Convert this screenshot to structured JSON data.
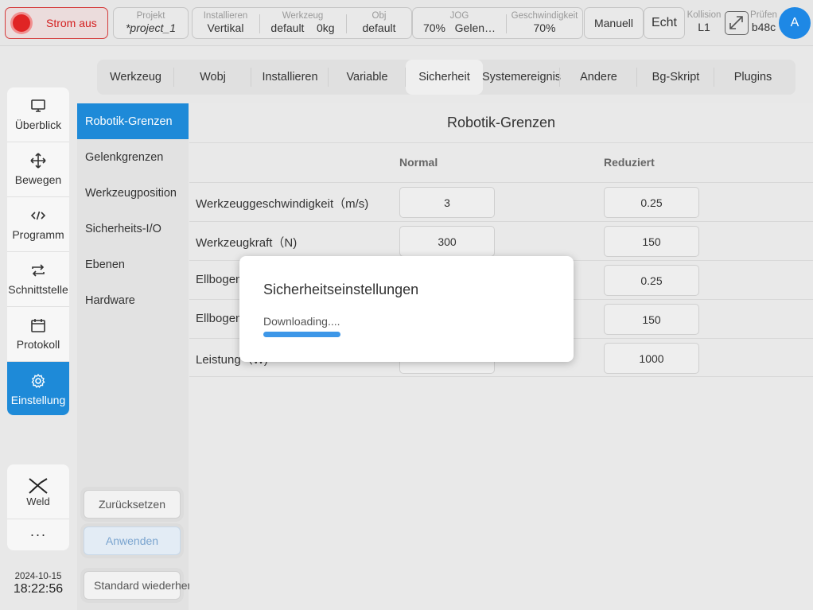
{
  "topbar": {
    "power_label": "Strom aus",
    "project": {
      "title": "Projekt",
      "value": "*project_1"
    },
    "install": {
      "title": "Installieren",
      "value": "Vertikal"
    },
    "tool": {
      "title": "Werkzeug",
      "value": "default",
      "weight": "0kg"
    },
    "obj": {
      "title": "Obj",
      "value": "default"
    },
    "jog": {
      "title": "JOG",
      "value": "70%",
      "mode": "Gelen…"
    },
    "speed": {
      "title": "Geschwindigkeit",
      "value": "70%"
    },
    "manual_label": "Manuell",
    "real_label": "Echt",
    "collision": {
      "title": "Kollision",
      "value": "L1"
    },
    "check": {
      "title": "Prüfen",
      "value": "b48c"
    },
    "avatar_letter": "A"
  },
  "sidebar": {
    "items": [
      {
        "label": "Überblick",
        "icon": "monitor-icon"
      },
      {
        "label": "Bewegen",
        "icon": "move-icon"
      },
      {
        "label": "Programm",
        "icon": "code-icon"
      },
      {
        "label": "Schnittstelle",
        "icon": "swap-icon"
      },
      {
        "label": "Protokoll",
        "icon": "calendar-icon"
      },
      {
        "label": "Einstellung",
        "icon": "gear-icon",
        "active": true
      }
    ],
    "weld_label": "Weld",
    "more_label": "···"
  },
  "datetime": {
    "date": "2024-10-15",
    "time": "18:22:56"
  },
  "tabs": [
    "Werkzeug",
    "Wobj",
    "Installieren",
    "Variable",
    "Sicherheit",
    "Systemereignis",
    "Andere",
    "Bg-Skript",
    "Plugins"
  ],
  "active_tab": "Sicherheit",
  "subnav": {
    "items": [
      "Robotik-Grenzen",
      "Gelenkgrenzen",
      "Werkzeugposition",
      "Sicherheits-I/O",
      "Ebenen",
      "Hardware"
    ],
    "reset_label": "Zurücksetzen",
    "apply_label": "Anwenden",
    "standard_label": "Standard wiederherstellen"
  },
  "content": {
    "title": "Robotik-Grenzen",
    "col_normal": "Normal",
    "col_reduced": "Reduziert",
    "rows": [
      {
        "label": "Werkzeuggeschwindigkeit（m/s)",
        "normal": "3",
        "reduced": "0.25"
      },
      {
        "label": "Werkzeugkraft（N)",
        "normal": "300",
        "reduced": "150"
      },
      {
        "label": "Ellbogen",
        "normal": "",
        "reduced": "0.25"
      },
      {
        "label": "Ellbogen",
        "normal": "",
        "reduced": "150"
      },
      {
        "label": "Leistung（W)",
        "normal": "",
        "reduced": "1000"
      }
    ]
  },
  "modal": {
    "title": "Sicherheitseinstellungen",
    "status": "Downloading....",
    "progress": 0.27,
    "accent": "#3d97e8"
  }
}
